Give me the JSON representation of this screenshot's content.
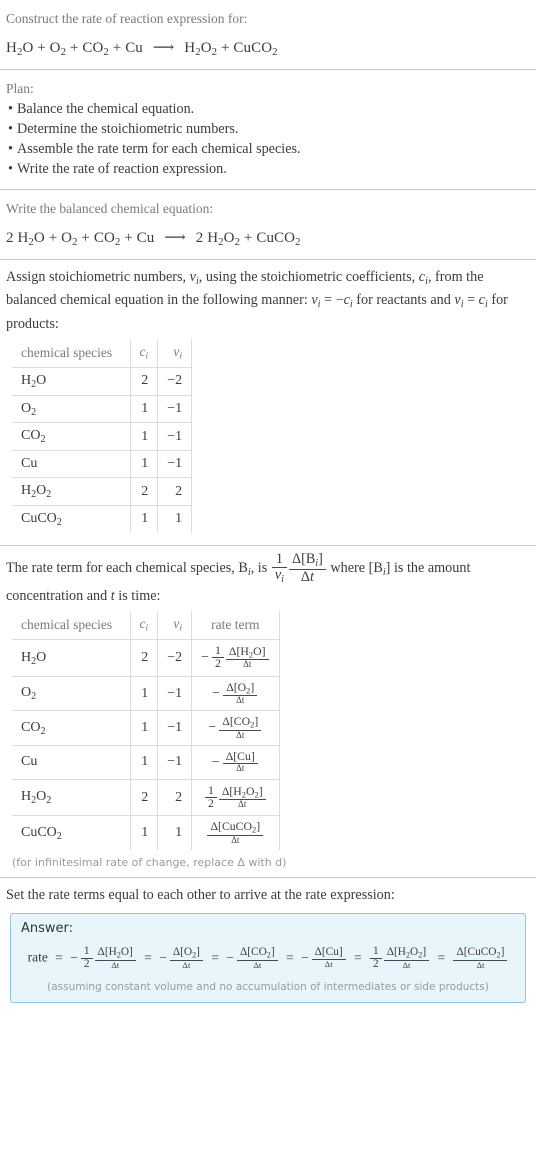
{
  "prompt": {
    "title": "Construct the rate of reaction expression for:",
    "equation_plain": "H2O + O2 + CO2 + Cu ⟶ H2O2 + CuCO2"
  },
  "plan": {
    "heading": "Plan:",
    "bullet": "•",
    "items": [
      "Balance the chemical equation.",
      "Determine the stoichiometric numbers.",
      "Assemble the rate term for each chemical species.",
      "Write the rate of reaction expression."
    ]
  },
  "balanced": {
    "heading": "Write the balanced chemical equation:",
    "equation_plain": "2 H2O + O2 + CO2 + Cu ⟶ 2 H2O2 + CuCO2",
    "reactants": [
      {
        "coefficient": "2",
        "formula": "H2O"
      },
      {
        "coefficient": "",
        "formula": "O2"
      },
      {
        "coefficient": "",
        "formula": "CO2"
      },
      {
        "coefficient": "",
        "formula": "Cu"
      }
    ],
    "products": [
      {
        "coefficient": "2",
        "formula": "H2O2"
      },
      {
        "coefficient": "",
        "formula": "CuCO2"
      }
    ],
    "arrow": "⟶"
  },
  "assign": {
    "text_part1": "Assign stoichiometric numbers, ",
    "nu_i": "νi",
    "text_part2": ", using the stoichiometric coefficients, ",
    "c_i": "ci",
    "text_part3": ", from the balanced chemical equation in the following manner: ",
    "rule_reactants": "νi = −ci",
    "text_part4": " for reactants and ",
    "rule_products": "νi = ci",
    "text_part5": " for products:"
  },
  "stoich_table": {
    "headers": [
      "chemical species",
      "c_i",
      "ν_i"
    ],
    "rows": [
      {
        "species": "H2O",
        "c": "2",
        "nu": "−2"
      },
      {
        "species": "O2",
        "c": "1",
        "nu": "−1"
      },
      {
        "species": "CO2",
        "c": "1",
        "nu": "−1"
      },
      {
        "species": "Cu",
        "c": "1",
        "nu": "−1"
      },
      {
        "species": "H2O2",
        "c": "2",
        "nu": "2"
      },
      {
        "species": "CuCO2",
        "c": "1",
        "nu": "1"
      }
    ]
  },
  "rate_intro": {
    "text_part1": "The rate term for each chemical species, ",
    "b_i": "Bi",
    "text_part2": ", is ",
    "formula_plain": "1/νi · Δ[Bi]/Δt",
    "text_part3": " where ",
    "bracket_b_i": "[Bi]",
    "text_part4": " is the amount concentration and ",
    "t": "t",
    "text_part5": " is time:"
  },
  "rate_table": {
    "headers": [
      "chemical species",
      "c_i",
      "ν_i",
      "rate term"
    ],
    "rows": [
      {
        "species": "H2O",
        "c": "2",
        "nu": "−2",
        "sign": "−",
        "coef_num": "1",
        "coef_den": "2",
        "numerator": "Δ[H2O]",
        "denominator": "Δt"
      },
      {
        "species": "O2",
        "c": "1",
        "nu": "−1",
        "sign": "−",
        "coef_num": "",
        "coef_den": "",
        "numerator": "Δ[O2]",
        "denominator": "Δt"
      },
      {
        "species": "CO2",
        "c": "1",
        "nu": "−1",
        "sign": "−",
        "coef_num": "",
        "coef_den": "",
        "numerator": "Δ[CO2]",
        "denominator": "Δt"
      },
      {
        "species": "Cu",
        "c": "1",
        "nu": "−1",
        "sign": "−",
        "coef_num": "",
        "coef_den": "",
        "numerator": "Δ[Cu]",
        "denominator": "Δt"
      },
      {
        "species": "H2O2",
        "c": "2",
        "nu": "2",
        "sign": "",
        "coef_num": "1",
        "coef_den": "2",
        "numerator": "Δ[H2O2]",
        "denominator": "Δt"
      },
      {
        "species": "CuCO2",
        "c": "1",
        "nu": "1",
        "sign": "",
        "coef_num": "",
        "coef_den": "",
        "numerator": "Δ[CuCO2]",
        "denominator": "Δt"
      }
    ],
    "footnote": "(for infinitesimal rate of change, replace Δ with d)"
  },
  "final": {
    "heading": "Set the rate terms equal to each other to arrive at the rate expression:",
    "answer_label": "Answer:",
    "rate_label": "rate",
    "equals": "=",
    "expression_plain": "rate = −1/2 Δ[H2O]/Δt = −Δ[O2]/Δt = −Δ[CO2]/Δt = −Δ[Cu]/Δt = 1/2 Δ[H2O2]/Δt = Δ[CuCO2]/Δt",
    "terms": [
      {
        "sign": "−",
        "coef_num": "1",
        "coef_den": "2",
        "numerator": "Δ[H2O]",
        "denominator": "Δt"
      },
      {
        "sign": "−",
        "coef_num": "",
        "coef_den": "",
        "numerator": "Δ[O2]",
        "denominator": "Δt"
      },
      {
        "sign": "−",
        "coef_num": "",
        "coef_den": "",
        "numerator": "Δ[CO2]",
        "denominator": "Δt"
      },
      {
        "sign": "−",
        "coef_num": "",
        "coef_den": "",
        "numerator": "Δ[Cu]",
        "denominator": "Δt"
      },
      {
        "sign": "",
        "coef_num": "1",
        "coef_den": "2",
        "numerator": "Δ[H2O2]",
        "denominator": "Δt"
      },
      {
        "sign": "",
        "coef_num": "",
        "coef_den": "",
        "numerator": "Δ[CuCO2]",
        "denominator": "Δt"
      }
    ],
    "assumption": "(assuming constant volume and no accumulation of intermediates or side products)"
  },
  "colors": {
    "answer_bg": "#e8f6fc",
    "answer_border": "#8fc5e0",
    "divider": "#c8c8c8",
    "muted_text": "#7a7a7a",
    "body_text": "#3c3c3c"
  }
}
